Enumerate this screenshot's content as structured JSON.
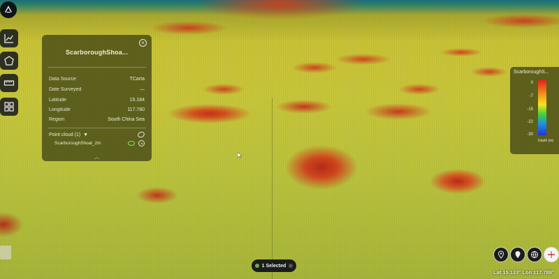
{
  "app": {
    "logo_icon": "app-logo-icon"
  },
  "toolbar": {
    "items": [
      {
        "name": "chart-icon"
      },
      {
        "name": "shape-icon"
      },
      {
        "name": "ruler-icon"
      },
      {
        "name": "layers-icon"
      }
    ]
  },
  "info_panel": {
    "title": "ScarboroughShoa...",
    "close_label": "×",
    "fields": [
      {
        "key": "Data Source",
        "value": "TCarta"
      },
      {
        "key": "Date Surveyed",
        "value": "—"
      },
      {
        "key": "Latitude",
        "value": "15.184"
      },
      {
        "key": "Longitude",
        "value": "117.780"
      },
      {
        "key": "Region",
        "value": "South China Sea"
      }
    ],
    "point_cloud": {
      "label": "Point cloud (1)",
      "toggle": "▼",
      "items": [
        {
          "name": "ScarboroughShoal_2m"
        }
      ]
    },
    "collapse_label": "︿"
  },
  "legend": {
    "title": "ScarboroughS...",
    "ticks": [
      "0",
      "-7",
      "-15",
      "-22",
      "-30"
    ],
    "unit": "Depth (m)",
    "colors": [
      "#e21d1d",
      "#f28c1b",
      "#f7e21f",
      "#42d33a",
      "#1a8fe8",
      "#2b2fd4"
    ]
  },
  "selection": {
    "label": "1 Selected"
  },
  "map_controls": [
    {
      "name": "location-pin-icon"
    },
    {
      "name": "marker-icon"
    },
    {
      "name": "globe-icon"
    },
    {
      "name": "compass-icon"
    }
  ],
  "status": {
    "coords": "Lat 15.133° Lon 117.788°"
  }
}
